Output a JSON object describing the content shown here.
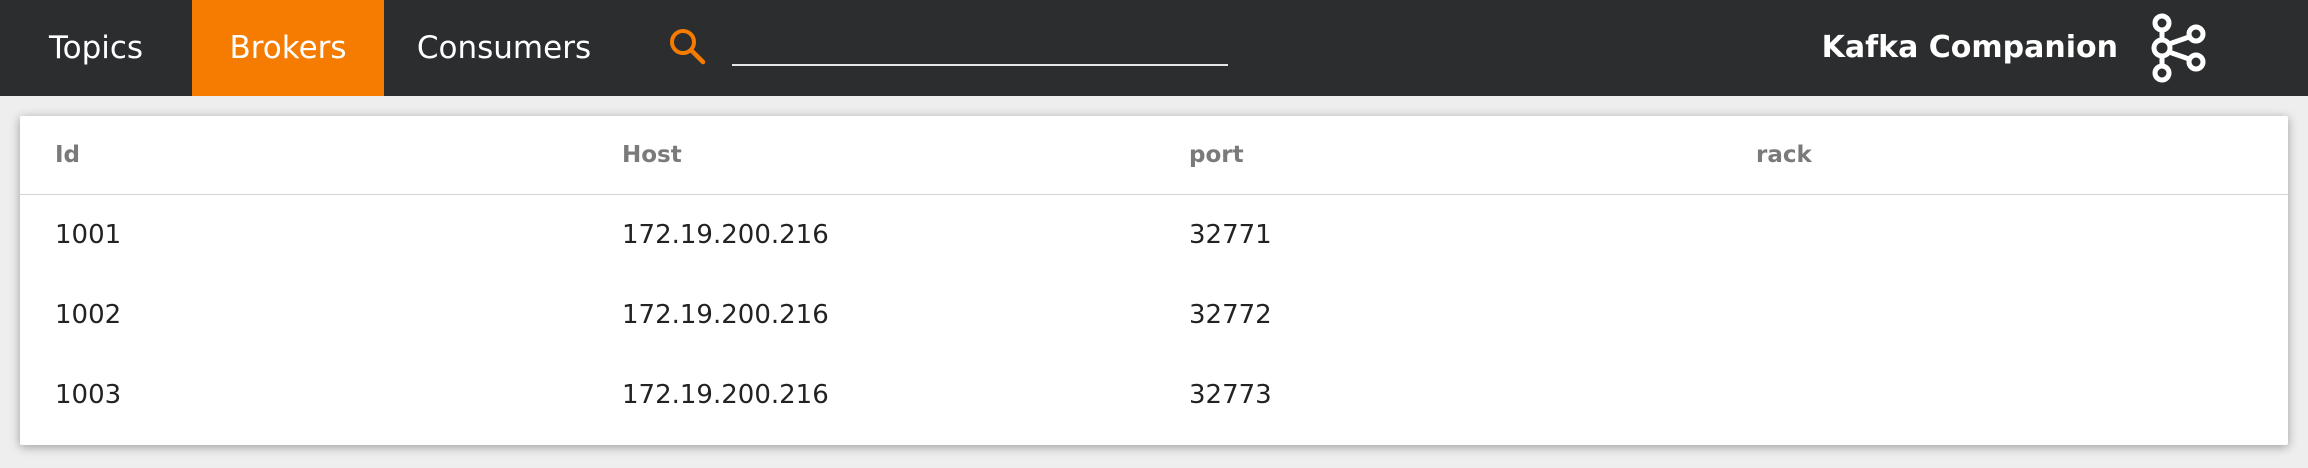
{
  "nav": {
    "tabs": [
      {
        "label": "Topics",
        "active": false
      },
      {
        "label": "Brokers",
        "active": true
      },
      {
        "label": "Consumers",
        "active": false
      }
    ],
    "search": {
      "value": "",
      "placeholder": ""
    },
    "brand": "Kafka Companion",
    "icons": {
      "search": "search-icon",
      "logo": "kafka-logo-icon"
    },
    "colors": {
      "bar": "#2b2d2f",
      "accent": "#f57c00"
    }
  },
  "table": {
    "headers": [
      "Id",
      "Host",
      "port",
      "rack"
    ],
    "rows": [
      [
        "1001",
        "172.19.200.216",
        "32771",
        ""
      ],
      [
        "1002",
        "172.19.200.216",
        "32772",
        ""
      ],
      [
        "1003",
        "172.19.200.216",
        "32773",
        ""
      ]
    ]
  }
}
